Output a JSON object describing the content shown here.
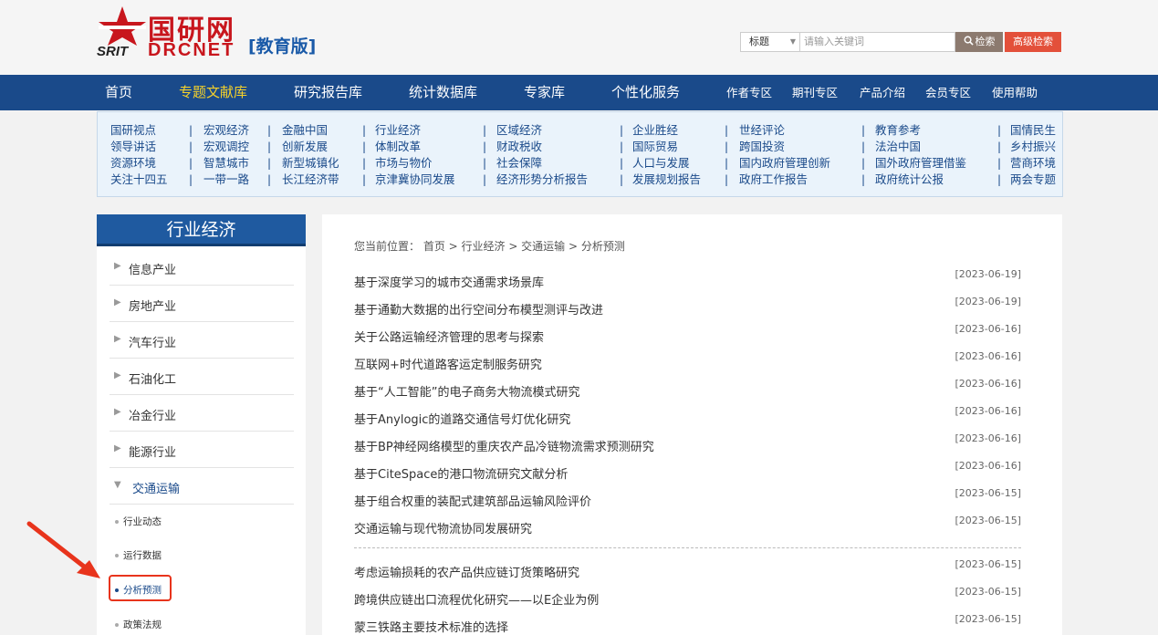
{
  "header": {
    "logo_cn": "国研网",
    "logo_srit": "SRIT",
    "logo_drcnet": "DRCNET",
    "logo_edition": "[教育版]",
    "search_type": "标题",
    "search_placeholder": "请输入关键词",
    "search_button": "检索",
    "advanced_button": "高级检索"
  },
  "nav": {
    "items": [
      "首页",
      "专题文献库",
      "研究报告库",
      "统计数据库",
      "专家库",
      "个性化服务"
    ],
    "small_items": [
      "作者专区",
      "期刊专区",
      "产品介绍",
      "会员专区",
      "使用帮助"
    ],
    "active": "专题文献库"
  },
  "subcategories": {
    "columns": [
      [
        "国研视点",
        "领导讲话",
        "资源环境",
        "关注十四五"
      ],
      [
        "宏观经济",
        "宏观调控",
        "智慧城市",
        "一带一路"
      ],
      [
        "金融中国",
        "创新发展",
        "新型城镇化",
        "长江经济带"
      ],
      [
        "行业经济",
        "体制改革",
        "市场与物价",
        "京津冀协同发展"
      ],
      [
        "区域经济",
        "财政税收",
        "社会保障",
        "经济形势分析报告"
      ],
      [
        "企业胜经",
        "国际贸易",
        "人口与发展",
        "发展规划报告"
      ],
      [
        "世经评论",
        "跨国投资",
        "国内政府管理创新",
        "政府工作报告"
      ],
      [
        "教育参考",
        "法治中国",
        "国外政府管理借鉴",
        "政府统计公报"
      ],
      [
        "国情民生",
        "乡村振兴",
        "营商环境",
        "两会专题"
      ]
    ],
    "separator": "|"
  },
  "sidebar": {
    "title": "行业经济",
    "items": [
      "信息产业",
      "房地产业",
      "汽车行业",
      "石油化工",
      "冶金行业",
      "能源行业",
      "交通运输"
    ],
    "open_item": "交通运输",
    "sub_items": [
      "行业动态",
      "运行数据",
      "分析预测",
      "政策法规"
    ],
    "active_sub": "分析预测"
  },
  "main": {
    "breadcrumb": "您当前位置： 首页 > 行业经济 > 交通运输 > 分析预测",
    "articles": [
      {
        "title": "基于深度学习的城市交通需求场景库",
        "date": "[2023-06-19]"
      },
      {
        "title": "基于通勤大数据的出行空间分布模型测评与改进",
        "date": "[2023-06-19]"
      },
      {
        "title": "关于公路运输经济管理的思考与探索",
        "date": "[2023-06-16]"
      },
      {
        "title": "互联网+时代道路客运定制服务研究",
        "date": "[2023-06-16]"
      },
      {
        "title": "基于“人工智能”的电子商务大物流模式研究",
        "date": "[2023-06-16]"
      },
      {
        "title": "基于Anylogic的道路交通信号灯优化研究",
        "date": "[2023-06-16]"
      },
      {
        "title": "基于BP神经网络模型的重庆农产品冷链物流需求预测研究",
        "date": "[2023-06-16]"
      },
      {
        "title": "基于CiteSpace的港口物流研究文献分析",
        "date": "[2023-06-16]"
      },
      {
        "title": "基于组合权重的装配式建筑部品运输风险评价",
        "date": "[2023-06-15]"
      },
      {
        "title": "交通运输与现代物流协同发展研究",
        "date": "[2023-06-15]"
      }
    ],
    "articles2": [
      {
        "title": "考虑运输损耗的农产品供应链订货策略研究",
        "date": "[2023-06-15]"
      },
      {
        "title": "跨境供应链出口流程优化研究——以E企业为例",
        "date": "[2023-06-15]"
      },
      {
        "title": "蒙三铁路主要技术标准的选择",
        "date": "[2023-06-15]"
      }
    ]
  },
  "colors": {
    "nav_bg": "#1a4a8a",
    "accent_red": "#c8161d",
    "active_nav": "#f5d12a",
    "annotation": "#e8341c"
  }
}
